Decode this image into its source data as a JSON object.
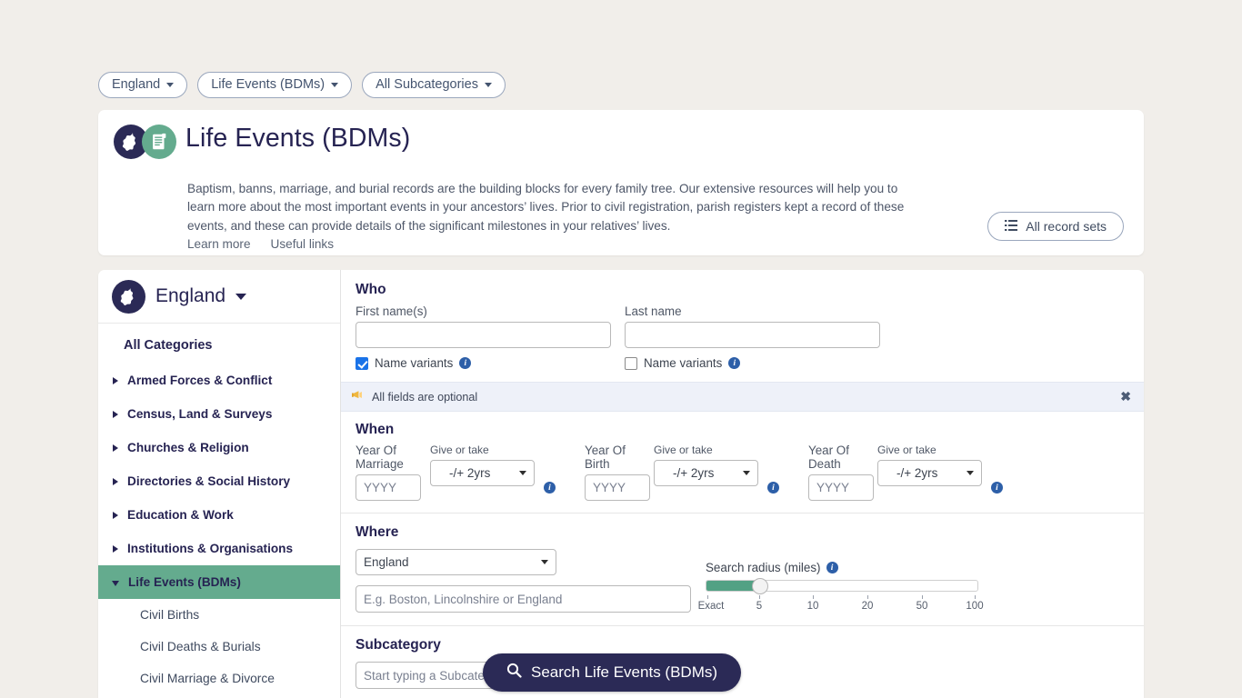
{
  "breadcrumb": {
    "chips": [
      {
        "label": "England",
        "icon": "chevron-down-icon"
      },
      {
        "label": "Life Events (BDMs)",
        "icon": "chevron-down-icon"
      },
      {
        "label": "All Subcategories",
        "icon": "chevron-down-icon"
      }
    ]
  },
  "hero": {
    "icons": [
      "england-map-icon",
      "records-document-icon"
    ],
    "title": "Life Events (BDMs)",
    "description": "Baptism, banns, marriage, and burial records are the building blocks for every family tree. Our extensive resources will help you to learn more about the most important events in your ancestors’ lives. Prior to civil registration, parish registers kept a record of these events, and these can provide details of the significant milestones in your relatives’ lives.",
    "links": [
      {
        "label": "Learn more"
      },
      {
        "label": "Useful links"
      }
    ],
    "all_record_sets": {
      "label": "All record sets",
      "icon": "list-icon"
    }
  },
  "sidebar": {
    "header": {
      "label": "England",
      "icon": "england-map-icon",
      "caret": "chevron-down-icon"
    },
    "all_categories_label": "All Categories",
    "items": [
      {
        "label": "Armed Forces & Conflict",
        "state": "collapsed"
      },
      {
        "label": "Census, Land & Surveys",
        "state": "collapsed"
      },
      {
        "label": "Churches & Religion",
        "state": "collapsed"
      },
      {
        "label": "Directories & Social History",
        "state": "collapsed"
      },
      {
        "label": "Education & Work",
        "state": "collapsed"
      },
      {
        "label": "Institutions & Organisations",
        "state": "collapsed"
      },
      {
        "label": "Life Events (BDMs)",
        "state": "expanded"
      }
    ],
    "subitems": [
      {
        "label": "Civil Births"
      },
      {
        "label": "Civil Deaths & Burials"
      },
      {
        "label": "Civil Marriage & Divorce"
      }
    ]
  },
  "form": {
    "who": {
      "title": "Who",
      "first_name": {
        "label": "First name(s)",
        "value": "",
        "placeholder": ""
      },
      "last_name": {
        "label": "Last name",
        "value": "",
        "placeholder": ""
      },
      "first_variants": {
        "label": "Name variants",
        "checked": true
      },
      "last_variants": {
        "label": "Name variants",
        "checked": false
      }
    },
    "notice": {
      "icon": "megaphone-icon",
      "text": "All fields are optional",
      "close": "✖"
    },
    "when": {
      "title": "When",
      "fields": [
        {
          "label": "Year Of Marriage",
          "placeholder": "YYYY",
          "value": "",
          "give_or_take_label": "Give or take",
          "give_or_take_value": "-/+ 2yrs"
        },
        {
          "label": "Year Of Birth",
          "placeholder": "YYYY",
          "value": "",
          "give_or_take_label": "Give or take",
          "give_or_take_value": "-/+ 2yrs"
        },
        {
          "label": "Year Of Death",
          "placeholder": "YYYY",
          "value": "",
          "give_or_take_label": "Give or take",
          "give_or_take_value": "-/+ 2yrs"
        }
      ]
    },
    "where": {
      "title": "Where",
      "country": {
        "value": "England"
      },
      "place": {
        "value": "",
        "placeholder": "E.g. Boston, Lincolnshire or England"
      },
      "radius": {
        "label": "Search radius (miles)",
        "ticks": [
          "Exact",
          "5",
          "10",
          "20",
          "50",
          "100"
        ],
        "value": "5"
      }
    },
    "subcategory": {
      "title": "Subcategory",
      "placeholder": "Start typing a Subcategory or Select a Subcategory",
      "value": ""
    },
    "search_button": {
      "label": "Search Life Events (BDMs)",
      "icon": "search-icon"
    }
  },
  "colors": {
    "page_background": "#f1eeea",
    "accent_green": "#64ab8e",
    "accent_navy": "#2b2a56",
    "checkbox_blue": "#1a73e8",
    "notice_background": "#eef1f9"
  }
}
